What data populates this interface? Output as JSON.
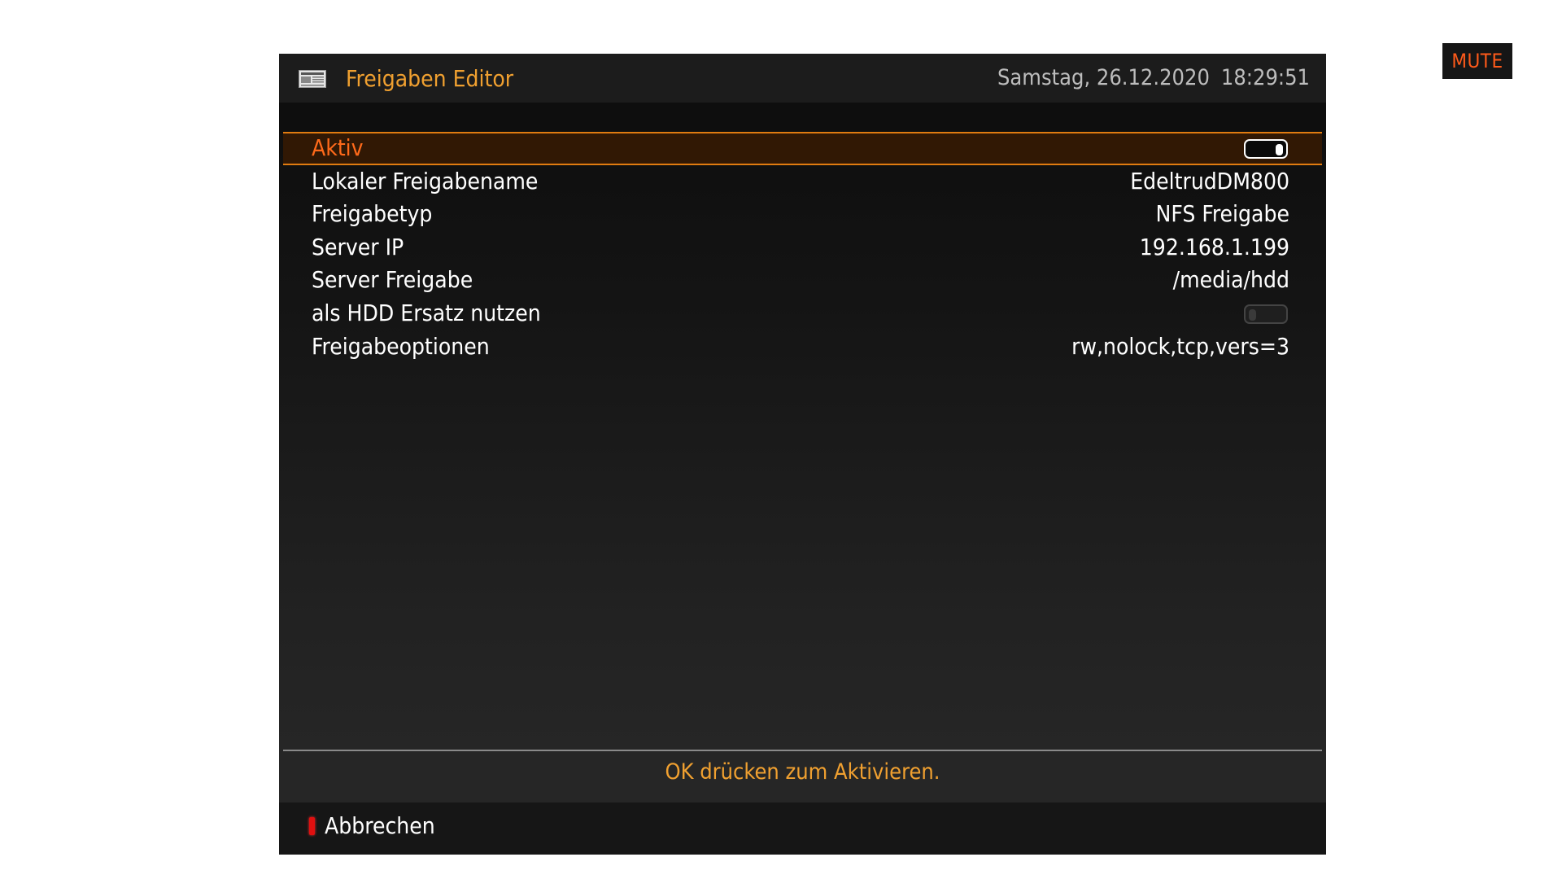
{
  "mute_label": "MUTE",
  "header": {
    "icon": "newspaper-icon",
    "title": "Freigaben Editor",
    "date": "Samstag, 26.12.2020",
    "time": "18:29:51"
  },
  "settings": [
    {
      "label": "Aktiv",
      "type": "toggle",
      "state": "on",
      "selected": true
    },
    {
      "label": "Lokaler Freigabename",
      "type": "text",
      "value": "EdeltrudDM800"
    },
    {
      "label": "Freigabetyp",
      "type": "text",
      "value": "NFS Freigabe"
    },
    {
      "label": "Server IP",
      "type": "text",
      "value": "192.168.1.199"
    },
    {
      "label": "Server Freigabe",
      "type": "text",
      "value": "/media/hdd"
    },
    {
      "label": "als HDD Ersatz nutzen",
      "type": "toggle",
      "state": "off"
    },
    {
      "label": "Freigabeoptionen",
      "type": "text",
      "value": "rw,nolock,tcp,vers=3"
    }
  ],
  "status_text": "OK drücken zum Aktivieren.",
  "footer": {
    "red_button_label": "Abbrechen"
  },
  "colors": {
    "accent": "#f0a030",
    "selection_text": "#ff6a1a",
    "selection_border": "#e07b10",
    "red_key": "#e01010"
  }
}
